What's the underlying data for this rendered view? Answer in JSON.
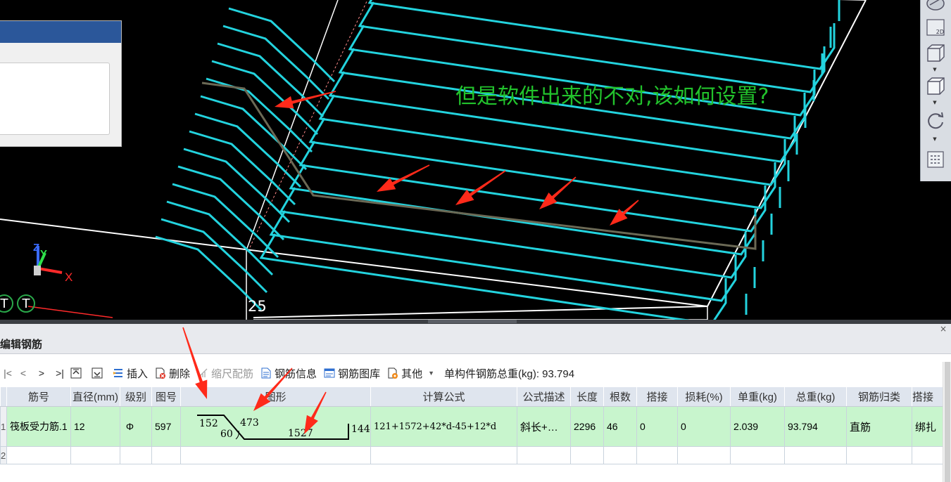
{
  "viewport": {
    "question_text": "但是软件出来的不对,该如何设置?",
    "axis_label": "25",
    "t_badges": [
      "T",
      "T"
    ],
    "axis_letters": {
      "z": "Z",
      "y": "Y",
      "x": "X"
    }
  },
  "right_toolbar": {
    "buttons": [
      "rotate-icon",
      "view-2d-button",
      "view-3d-box-button",
      "view-cube-button",
      "refresh-icon",
      "properties-panel-icon"
    ],
    "label_2d": "2D"
  },
  "panel": {
    "title": "编辑钢筋",
    "close": "×"
  },
  "toolbar": {
    "nav": [
      "|<",
      "<",
      ">",
      ">|"
    ],
    "insert": "插入",
    "delete": "删除",
    "scale_bar": "缩尺配筋",
    "rebar_info": "钢筋信息",
    "rebar_library": "钢筋图库",
    "other": "其他",
    "total_weight": "单构件钢筋总重(kg): 93.794"
  },
  "table": {
    "headers": [
      "",
      "筋号",
      "直径(mm)",
      "级别",
      "图号",
      "图形",
      "计算公式",
      "公式描述",
      "长度",
      "根数",
      "搭接",
      "损耗(%)",
      "单重(kg)",
      "总重(kg)",
      "钢筋归类",
      "搭接"
    ],
    "rows": [
      {
        "num": "1",
        "name": "筏板受力筋.1",
        "diameter": "12",
        "grade": " Φ",
        "fig_no": "597",
        "shape": {
          "seg1": "152",
          "seg2": "473",
          "angle": "60",
          "seg3": "1527",
          "seg4": "144"
        },
        "formula": "121+1572+42*d-45+12*d",
        "formula_desc": "斜长+…",
        "length": "2296",
        "count": "46",
        "lap": "0",
        "loss": "0",
        "unit_weight": "2.039",
        "total_weight": "93.794",
        "category": "直筋",
        "lap_type": "绑扎"
      },
      {
        "num": "2"
      }
    ]
  },
  "colors": {
    "rebar_cyan": "#23d3de",
    "frame_white": "#ffffff",
    "highlight_rebar": "#6b6955",
    "annotation_red": "#ff2a1a",
    "question_green": "#22c22c",
    "selected_row": "#c8f5cd",
    "header_bg": "#dfe5ee"
  }
}
